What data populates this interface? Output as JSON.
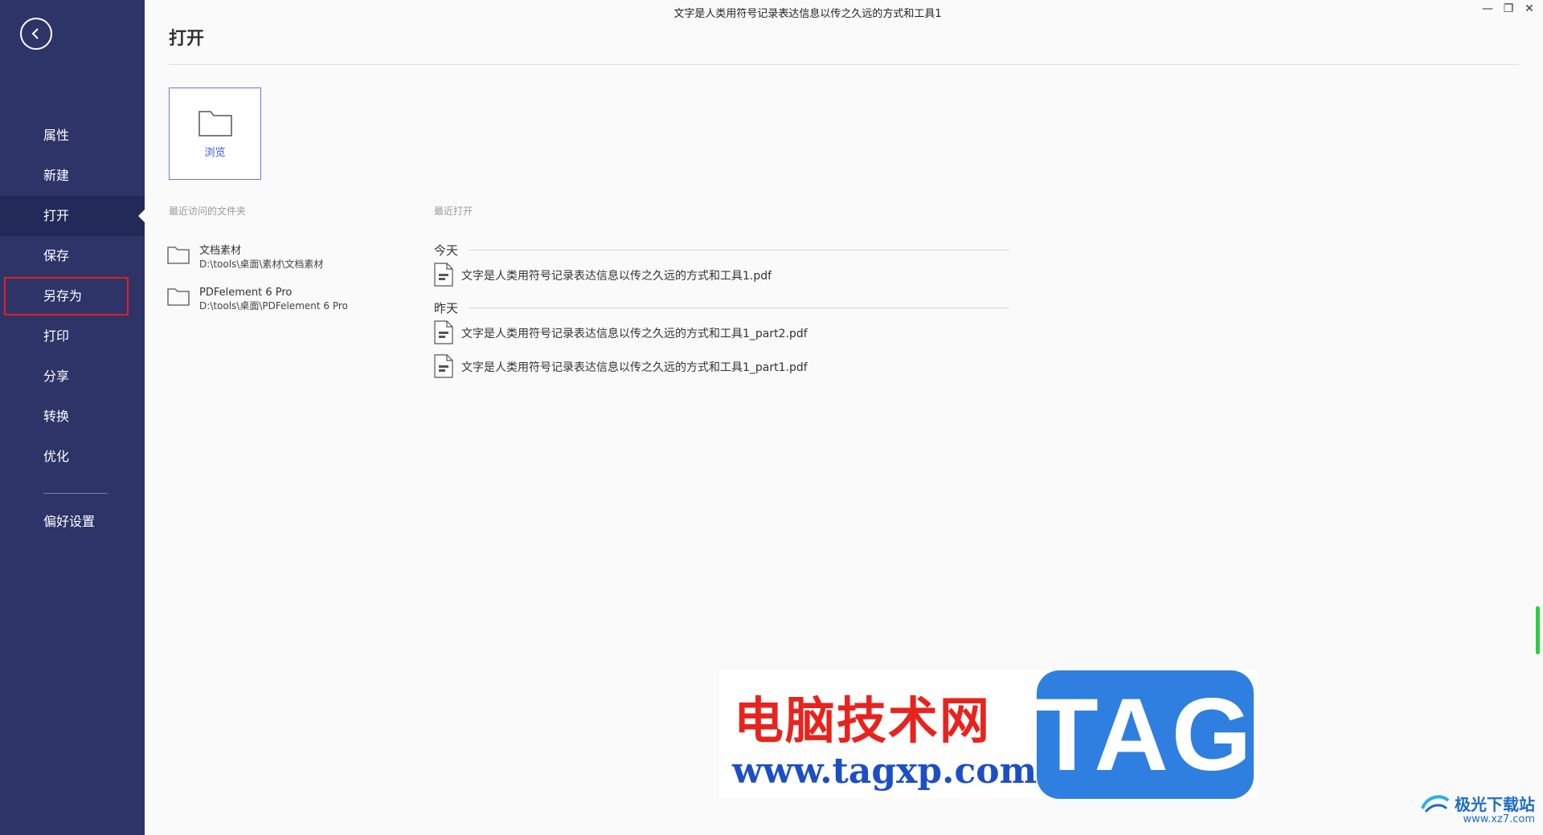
{
  "window": {
    "title": "文字是人类用符号记录表达信息以传之久远的方式和工具1",
    "controls": {
      "minimize": "—",
      "restore": "❐",
      "close": "✕"
    }
  },
  "sidebar": {
    "items": [
      {
        "label": "属性"
      },
      {
        "label": "新建"
      },
      {
        "label": "打开"
      },
      {
        "label": "保存"
      },
      {
        "label": "另存为"
      },
      {
        "label": "打印"
      },
      {
        "label": "分享"
      },
      {
        "label": "转换"
      },
      {
        "label": "优化"
      }
    ],
    "preferences_label": "偏好设置",
    "active_item": "打开",
    "highlighted_item": "另存为"
  },
  "main": {
    "title": "打开",
    "browse_label": "浏览",
    "recent_folders_label": "最近访问的文件夹",
    "recent_folders": [
      {
        "name": "文档素材",
        "path": "D:\\tools\\桌面\\素材\\文档素材"
      },
      {
        "name": "PDFelement 6 Pro",
        "path": "D:\\tools\\桌面\\PDFelement 6 Pro"
      }
    ],
    "recent_opened_label": "最近打开",
    "groups": [
      {
        "label": "今天",
        "files": [
          "文字是人类用符号记录表达信息以传之久远的方式和工具1.pdf"
        ]
      },
      {
        "label": "昨天",
        "files": [
          "文字是人类用符号记录表达信息以传之久远的方式和工具1_part2.pdf",
          "文字是人类用符号记录表达信息以传之久远的方式和工具1_part1.pdf"
        ]
      }
    ]
  },
  "watermark": {
    "cn": "电脑技术网",
    "url": "www.tagxp.com",
    "tag": "TAG",
    "site2_name": "极光下载站",
    "site2_url": "www.xz7.com"
  },
  "colors": {
    "sidebar_bg": "#2e3468",
    "active_bg": "#242a58",
    "highlight_border": "#e02020",
    "accent": "#3a5bd9"
  }
}
